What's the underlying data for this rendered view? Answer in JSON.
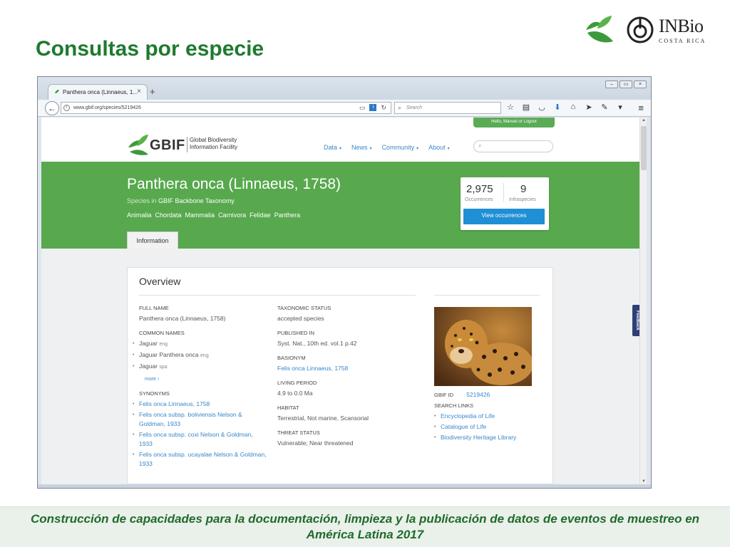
{
  "slide": {
    "title": "Consultas por especie",
    "footer": "Construcción de capacidades para la documentación, limpieza y la publicación de datos de eventos de muestreo en América Latina 2017"
  },
  "logos": {
    "inbio_name": "INBio",
    "inbio_sub": "COSTA RICA"
  },
  "browser": {
    "tab_label": "Panthera onca (Linnaeus, 1...",
    "tab_close": "×",
    "new_tab": "+",
    "url": "www.gbif.org/species/5219426",
    "search_placeholder": "Search",
    "window_buttons": [
      "–",
      "▭",
      "×"
    ]
  },
  "gbif": {
    "login_text": "Hello, Manuel or Logout",
    "logo_word": "GBIF",
    "logo_full_line1": "Global Biodiversity",
    "logo_full_line2": "Information Facility",
    "nav": [
      "Data",
      "News",
      "Community",
      "About"
    ],
    "feedback": "Feedback"
  },
  "species": {
    "title": "Panthera onca (Linnaeus, 1758)",
    "in_prefix": "Species in",
    "in_dataset": "GBIF Backbone Taxonomy",
    "taxonomy": [
      "Animalia",
      "Chordata",
      "Mammalia",
      "Carnivora",
      "Felidae",
      "Panthera"
    ],
    "tab_information": "Information",
    "occurrences_count": "2,975",
    "occurrences_label": "Occurrences",
    "infraspecies_count": "9",
    "infraspecies_label": "Infraspecies",
    "view_button": "View occurrences"
  },
  "overview": {
    "title": "Overview",
    "full_name_label": "FULL NAME",
    "full_name": "Panthera onca (Linnaeus, 1758)",
    "common_names_label": "COMMON NAMES",
    "common_names": [
      {
        "name": "Jaguar",
        "lang": "eng"
      },
      {
        "name": "Jaguar Panthera onca",
        "lang": "eng"
      },
      {
        "name": "Jaguar",
        "lang": "spa"
      }
    ],
    "more": "more ›",
    "synonyms_label": "SYNONYMS",
    "synonyms": [
      "Felis onca Linnaeus, 1758",
      "Felis onca subsp. boliviensis Nelson & Goldman, 1933",
      "Felis onca subsp. coxi Nelson & Goldman, 1933",
      "Felis onca subsp. ucayalae Nelson & Goldman, 1933"
    ],
    "taxonomic_status_label": "TAXONOMIC STATUS",
    "taxonomic_status": "accepted species",
    "published_in_label": "PUBLISHED IN",
    "published_in": "Syst. Nat., 10th ed. vol.1 p.42",
    "basionym_label": "BASIONYM",
    "basionym": "Felis onca Linnaeus, 1758",
    "living_period_label": "LIVING PERIOD",
    "living_period": "4.9 to 0.0 Ma",
    "habitat_label": "HABITAT",
    "habitat": "Terrestrial, Not marine, Scansorial",
    "threat_status_label": "THREAT STATUS",
    "threat_status": "Vulnerable; Near threatened",
    "gbif_id_label": "GBIF ID",
    "gbif_id": "5219426",
    "search_links_label": "SEARCH LINKS",
    "search_links": [
      "Encyclopedia of Life",
      "Catalogue of Life",
      "Biodiversity Heritage Library"
    ]
  },
  "colors": {
    "slide_title": "#1e7a2e",
    "gbif_green": "#58a84e",
    "link_blue": "#3a87c8",
    "button_blue": "#1f8fd6"
  }
}
